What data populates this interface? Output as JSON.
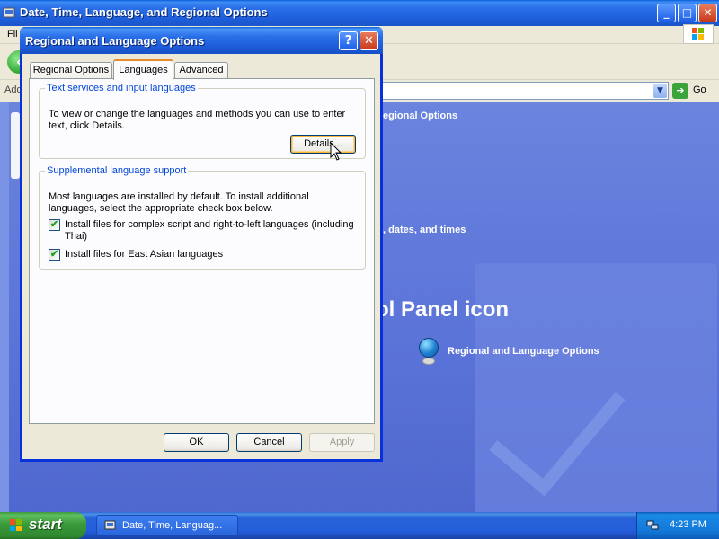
{
  "background_window": {
    "title": "Date, Time, Language, and Regional Options",
    "menu_text": "Fil",
    "address_label": "Add",
    "go_label": "Go",
    "controls": {
      "minimize": "_",
      "maximize": "□",
      "close": "✕"
    }
  },
  "content": {
    "heading_1": "egional Options",
    "heading_2": ", dates, and times",
    "heading_big": "ol Panel icon",
    "link_regional": "Regional and Language Options"
  },
  "dialog": {
    "title": "Regional and Language Options",
    "help_label": "?",
    "close_label": "✕",
    "tabs": [
      {
        "label": "Regional Options",
        "active": false
      },
      {
        "label": "Languages",
        "active": true
      },
      {
        "label": "Advanced",
        "active": false
      }
    ],
    "group_text_services": {
      "legend": "Text services and input languages",
      "description": "To view or change the languages and methods you can use to enter text, click Details.",
      "details_button": "Details..."
    },
    "group_supplemental": {
      "legend": "Supplemental language support",
      "description": "Most languages are installed by default. To install additional languages, select the appropriate check box below.",
      "checkboxes": [
        {
          "label": "Install files for complex script and right-to-left languages (including Thai)",
          "checked": true,
          "mark": "✔"
        },
        {
          "label": "Install files for East Asian languages",
          "checked": true,
          "mark": "✔"
        }
      ]
    },
    "buttons": {
      "ok": "OK",
      "cancel": "Cancel",
      "apply": "Apply"
    }
  },
  "taskbar": {
    "start_label": "start",
    "task_item_label": "Date, Time, Languag...",
    "clock": "4:23 PM"
  },
  "colors": {
    "title_blue": "#245edb",
    "content_blue": "#5a73d8",
    "legend_blue": "#0046d5",
    "start_green": "#3a9a3a",
    "dialog_face": "#ece9d8"
  }
}
